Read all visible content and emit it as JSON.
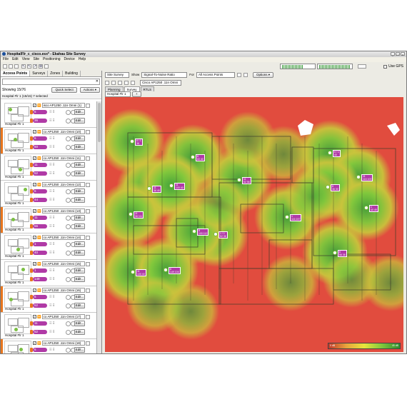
{
  "window": {
    "title": "HospitalFlr_c_cisco.esx* - Ekahau Site Survey",
    "min": "_",
    "max": "□",
    "close": "×"
  },
  "menu": [
    "File",
    "Edit",
    "View",
    "Site",
    "Positioning",
    "Device",
    "Help"
  ],
  "toolbar": {
    "use_gps_label": "Use GPS"
  },
  "left_panel": {
    "tabs": [
      "Access Points",
      "Surveys",
      "Zones",
      "Building"
    ],
    "search_placeholder": "",
    "showing_label": "Showing 15/76",
    "quick_select": "Quick Select",
    "actions": "Actions ▾",
    "group_line": "Hospital Flr 1 (15/15) 7 selected",
    "access_points": [
      {
        "floor": "Hospital Flr 1",
        "name": "isco AP1250 .11n Omni (1)",
        "channel": "6",
        "ch2": "36",
        "stripe": "#ffffff"
      },
      {
        "floor": "Hospital Flr 1",
        "name": "co AP1250 .11n Omni (10)",
        "channel": "6",
        "ch2": "60",
        "stripe": "#e8761e"
      },
      {
        "floor": "Hospital Flr 1",
        "name": "co AP1250 .11n Omni (11)",
        "channel": "11",
        "ch2": "52",
        "stripe": "#ffffff"
      },
      {
        "floor": "Hospital Flr 1",
        "name": "co AP1250 .11n Omni (12)",
        "channel": "6",
        "ch2": "44",
        "stripe": "#ffffff"
      },
      {
        "floor": "Hospital Flr 1",
        "name": "co AP1250 .11n Omni (13)",
        "channel": "11",
        "ch2": "56",
        "stripe": "#e8761e"
      },
      {
        "floor": "Hospital Flr 1",
        "name": "co AP1250 .11n Omni (14)",
        "channel": "1",
        "ch2": "40",
        "stripe": "#ffffff"
      },
      {
        "floor": "Hospital Flr 1",
        "name": "co AP1250 .11n Omni (15)",
        "channel": "1",
        "ch2": "149",
        "stripe": "#ffffff"
      },
      {
        "floor": "Hospital Flr 1",
        "name": "co AP1250 .11n Omni (16)",
        "channel": "6",
        "ch2": "52",
        "stripe": "#e8761e"
      },
      {
        "floor": "Hospital Flr 1",
        "name": "co AP1250 .11n Omni (17)",
        "channel": "11",
        "ch2": "52",
        "stripe": "#ffffff"
      },
      {
        "floor": "Hospital Flr 1",
        "name": "co AP1250 .11n Omni (18)",
        "channel": "6",
        "ch2": "36",
        "stripe": "#e8761e"
      }
    ],
    "edit_label": "Edit..."
  },
  "right_panel": {
    "view_select": "Site Survey",
    "show_label": "Show",
    "show_value": "Signal-To-Noise Ratio",
    "for_label": "For",
    "for_value": "All Access Points",
    "options": "Options ▾",
    "ap_select": "Cisco AP1250 .11n Omni",
    "subtabs": [
      "Planning",
      "Survey",
      "RTLS"
    ],
    "floor_select": "Hospital Flr 1",
    "floor_add": "+",
    "legend_min": "0 dB",
    "legend_max": "45 dB"
  },
  "map_aps": [
    {
      "label": "6 / 1",
      "label2": "36"
    },
    {
      "label": "6",
      "label2": "60 40"
    },
    {
      "label": "11",
      "label2": "36 49"
    },
    {
      "label": "11",
      "label2": "100 40"
    },
    {
      "label": "11",
      "label2": "36 111"
    },
    {
      "label": "1 / 1",
      "label2": "52 36"
    },
    {
      "label": "11",
      "label2": "52 56"
    },
    {
      "label": "6",
      "label2": "100 112"
    },
    {
      "label": "1",
      "label2": "116 157"
    },
    {
      "label": "6 / 1",
      "label2": "40"
    },
    {
      "label": "11",
      "label2": "116 100"
    },
    {
      "label": "6",
      "label2": "36 30"
    },
    {
      "label": "6",
      "label2": "56 36"
    },
    {
      "label": "1",
      "label2": "40 49"
    },
    {
      "label": "11",
      "label2": "100 40"
    },
    {
      "label": "6",
      "label2": "149 104"
    }
  ]
}
